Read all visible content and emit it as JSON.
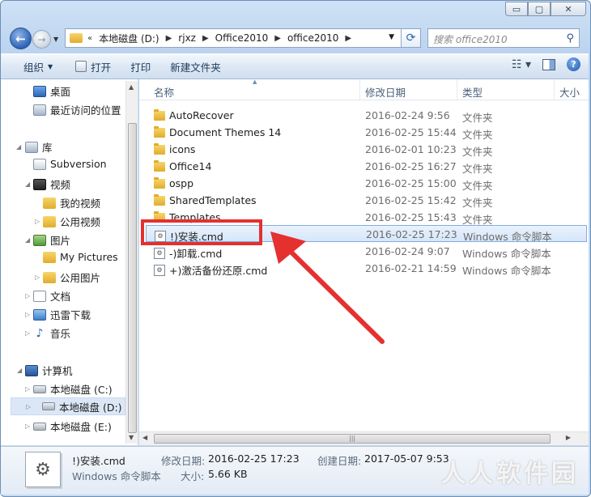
{
  "window": {
    "minimize": "▭",
    "maximize": "▢",
    "close": "✕"
  },
  "address": {
    "overflow": "«",
    "crumbs": [
      "本地磁盘 (D:)",
      "rjxz",
      "Office2010",
      "office2010"
    ],
    "search_placeholder": "搜索 office2010"
  },
  "toolbar": {
    "organize": "组织",
    "open": "打开",
    "print": "打印",
    "new_folder": "新建文件夹"
  },
  "nav": {
    "desktop": "桌面",
    "recent": "最近访问的位置",
    "libraries": "库",
    "subversion": "Subversion",
    "videos": "视频",
    "my_videos": "我的视频",
    "public_videos": "公用视频",
    "pictures": "图片",
    "my_pictures": "My Pictures",
    "public_pictures": "公用图片",
    "documents": "文档",
    "thunder": "迅雷下载",
    "music": "音乐",
    "computer": "计算机",
    "drive_c": "本地磁盘 (C:)",
    "drive_d": "本地磁盘 (D:)",
    "drive_e": "本地磁盘 (E:)"
  },
  "columns": {
    "name": "名称",
    "date": "修改日期",
    "type": "类型",
    "size": "大小"
  },
  "files": [
    {
      "name": "AutoRecover",
      "date": "2016-02-24 9:56",
      "type": "文件夹"
    },
    {
      "name": "Document Themes 14",
      "date": "2016-02-25 15:44",
      "type": "文件夹"
    },
    {
      "name": "icons",
      "date": "2016-02-01 10:23",
      "type": "文件夹"
    },
    {
      "name": "Office14",
      "date": "2016-02-25 16:27",
      "type": "文件夹"
    },
    {
      "name": "ospp",
      "date": "2016-02-25 15:00",
      "type": "文件夹"
    },
    {
      "name": "SharedTemplates",
      "date": "2016-02-25 15:42",
      "type": "文件夹"
    },
    {
      "name": "Templates",
      "date": "2016-02-25 15:43",
      "type": "文件夹"
    },
    {
      "name": "!)安装.cmd",
      "date": "2016-02-25 17:23",
      "type": "Windows 命令脚本"
    },
    {
      "name": "-)卸载.cmd",
      "date": "2016-02-24 9:07",
      "type": "Windows 命令脚本"
    },
    {
      "name": "+)激活备份还原.cmd",
      "date": "2016-02-21 14:59",
      "type": "Windows 命令脚本"
    }
  ],
  "details": {
    "filename": "!)安装.cmd",
    "filetype": "Windows 命令脚本",
    "modified_label": "修改日期:",
    "modified": "2016-02-25 17:23",
    "size_label": "大小:",
    "size": "5.66 KB",
    "created_label": "创建日期:",
    "created": "2017-05-07 9:53"
  },
  "watermark": "人人软件园",
  "colors": {
    "highlight_box": "#e53030",
    "selection": "#d5e6fa"
  }
}
